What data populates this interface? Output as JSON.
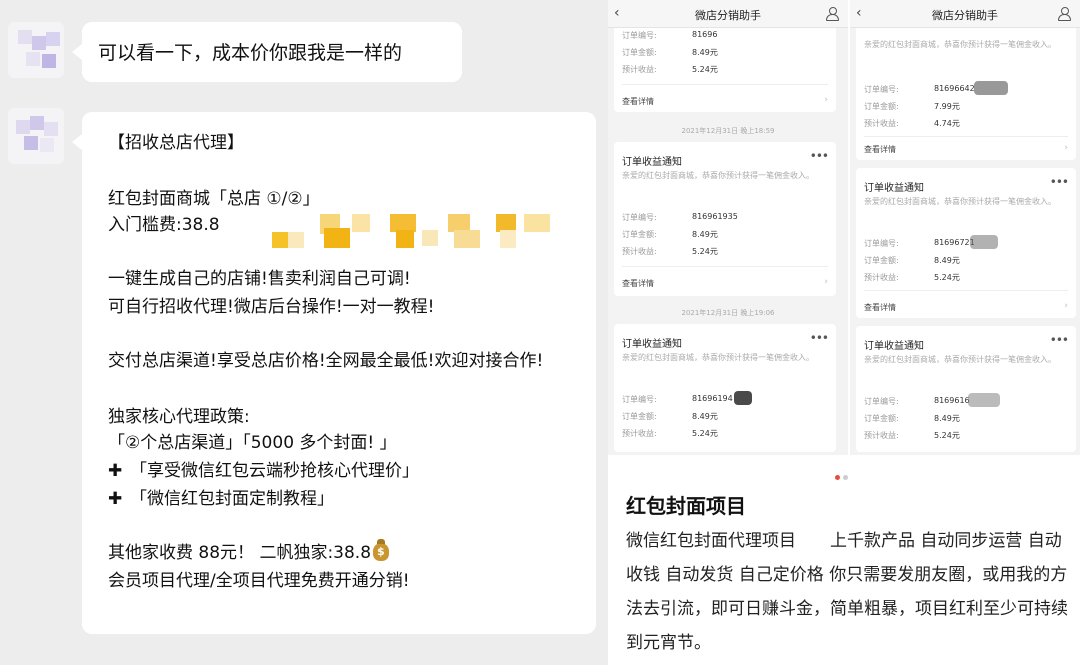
{
  "chat": {
    "message1": "可以看一下，成本价你跟我是一样的",
    "message2": {
      "heading": "【招收总店代理】",
      "shop_line": "红包封面商城「总店 ①/②」",
      "fee_line": "入门槛费:38.8",
      "feature1": "一键生成自己的店铺!售卖利润自己可调!",
      "feature2": "可自行招收代理!微店后台操作!一对一教程!",
      "delivery": "交付总店渠道!享受总店价格!全网最全最低!欢迎对接合作!",
      "policy_title": "独家核心代理政策:",
      "policy_items": "「②个总店渠道」「5000 多个封面! 」",
      "plus1": "「享受微信红包云端秒抢核心代理价」",
      "plus2": "「微信红包封面定制教程」",
      "other_price": "其他家收费 88元！ 二帆独家:38.8",
      "membership": "会员项目代理/全项目代理免费开通分销!"
    }
  },
  "right": {
    "app_title": "微店分销助手",
    "card_title": "订单收益通知",
    "card_desc": "亲爱的红包封面商城，恭喜你预计获得一笔佣金收入。",
    "label_order_no": "订单编号:",
    "label_order_amount": "订单金额:",
    "label_expected": "预计收益:",
    "view_details": "查看详情",
    "timestamp1": "2021年12月31日 晚上18:59",
    "timestamp2": "2021年12月31日 晚上19:06",
    "phone1": [
      {
        "order_no": "81696",
        "amount": "8.49元",
        "income": "5.24元"
      },
      {
        "order_no": "816961935",
        "amount": "8.49元",
        "income": "5.24元"
      },
      {
        "order_no": "81696194",
        "amount": "8.49元",
        "income": "5.24元"
      }
    ],
    "phone2": [
      {
        "order_no": "81696642",
        "amount": "7.99元",
        "income": "4.74元"
      },
      {
        "order_no": "81696721",
        "amount": "8.49元",
        "income": "5.24元"
      },
      {
        "order_no": "8169616",
        "amount": "8.49元",
        "income": "5.24元"
      }
    ],
    "project_title": "红包封面项目",
    "project_desc": "微信红包封面代理项目　　上千款产品 自动同步运营 自动收钱 自动发货 自己定价格 你只需要发朋友圈，或用我的方法去引流，即可日赚斗金，简单粗暴，项目红利至少可持续到元宵节。"
  },
  "colors": {
    "chat_bg": "#ededed",
    "bubble": "#ffffff",
    "pager_active": "#e84c3d",
    "pager_inactive": "#cccccc",
    "mosaic": "#f2b315"
  }
}
